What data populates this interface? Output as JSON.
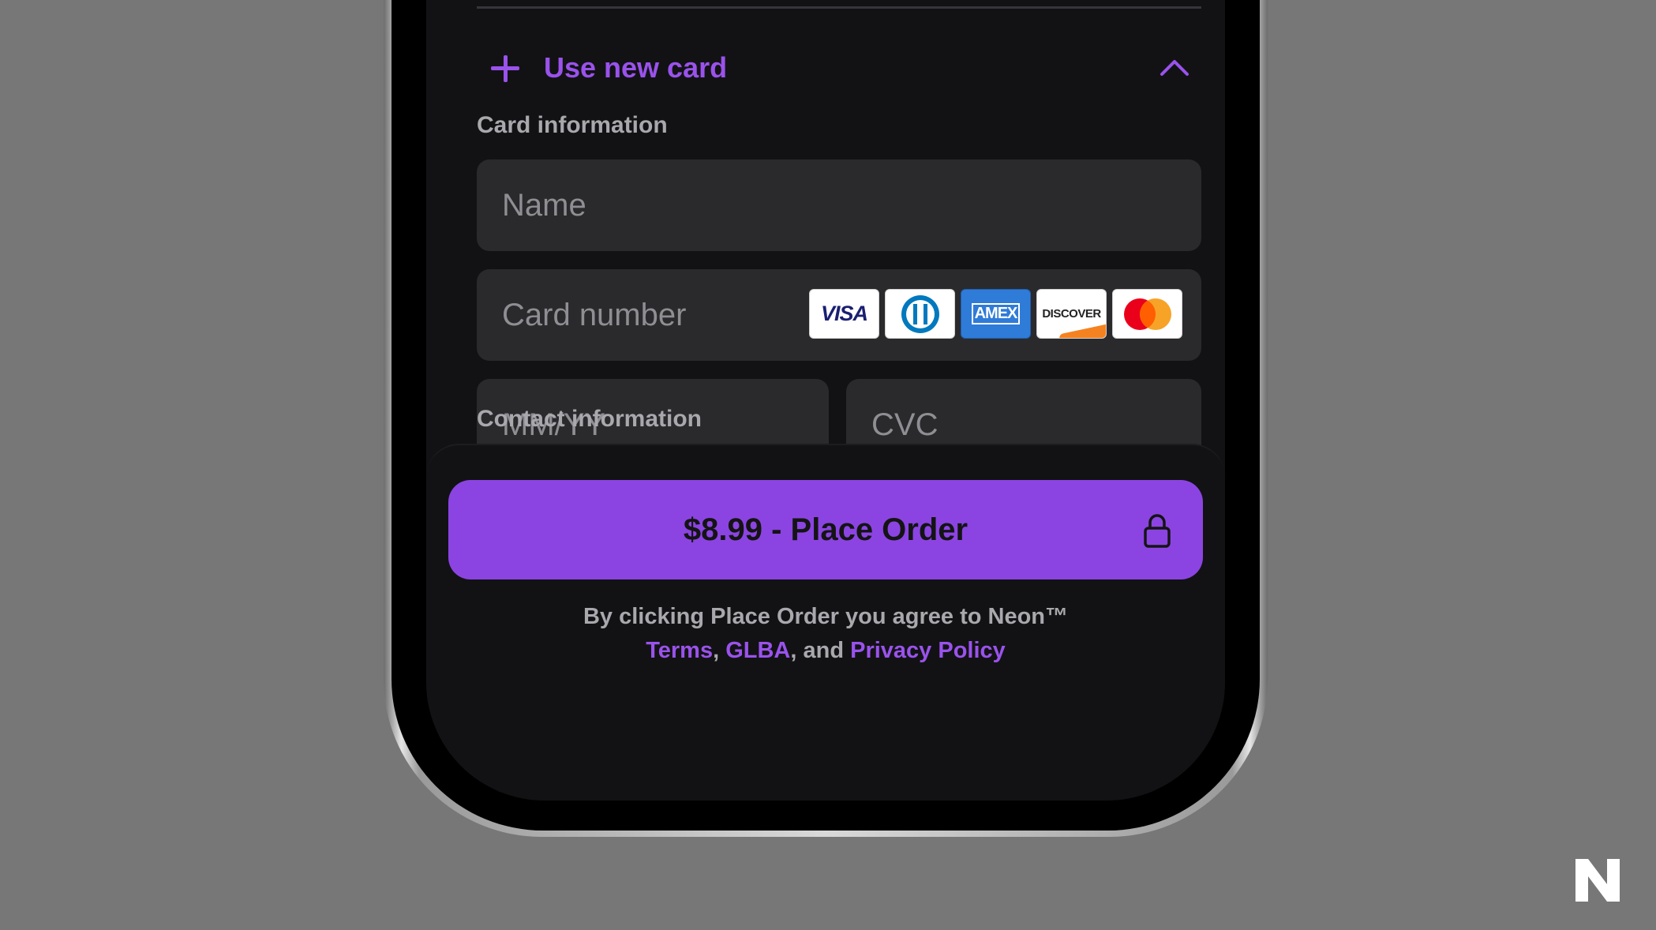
{
  "use_new_card": {
    "label": "Use new card",
    "plus_icon": "plus-icon",
    "chevron_icon": "chevron-up-icon"
  },
  "card_information": {
    "label": "Card information",
    "name_placeholder": "Name",
    "card_number_placeholder": "Card number",
    "expiry_placeholder": "MM/YY",
    "cvc_placeholder": "CVC",
    "card_brands": [
      "VISA",
      "Diners Club",
      "AMEX",
      "DISCOVER",
      "Mastercard"
    ]
  },
  "contact_information": {
    "label": "Contact information"
  },
  "place_order": {
    "label": "$8.99 - Place Order",
    "icon": "lock-icon"
  },
  "agreement": {
    "text": "By clicking Place Order you agree to Neon™",
    "terms": "Terms",
    "sep1": ", ",
    "glba": "GLBA",
    "sep2": ", and ",
    "privacy": "Privacy Policy"
  },
  "colors": {
    "accent": "#9a52ec",
    "button": "#8b44e2",
    "background": "#777777",
    "field": "#2a2a2c"
  }
}
